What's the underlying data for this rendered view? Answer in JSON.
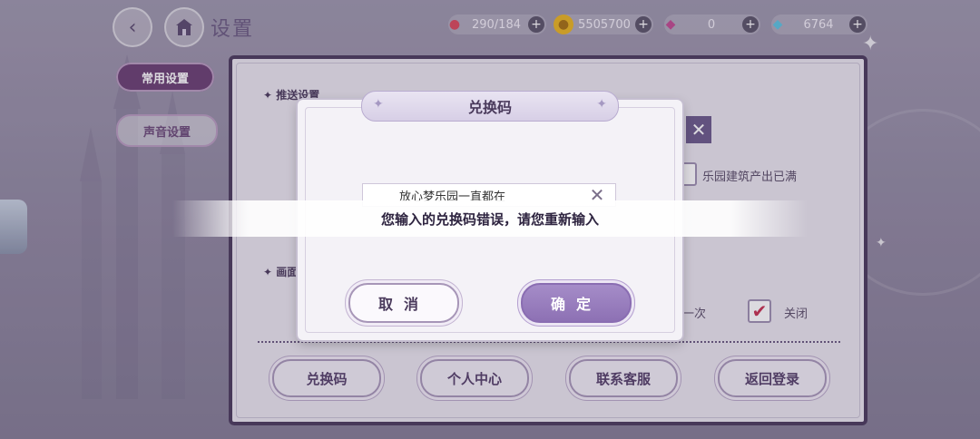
{
  "header": {
    "back_icon": "back-arrow-icon",
    "home_icon": "castle-home-icon",
    "title": "设置",
    "resources": [
      {
        "icon": "candy-icon",
        "value": "290/184",
        "color": "#d94a5c"
      },
      {
        "icon": "gold-coin-icon",
        "value": "5505700",
        "color": "#e8b420"
      },
      {
        "icon": "pink-diamond-icon",
        "value": "0",
        "color": "#c04a90"
      },
      {
        "icon": "blue-diamond-icon",
        "value": "6764",
        "color": "#5cc3e0"
      }
    ],
    "plus": "+"
  },
  "sidebar": {
    "tabs": [
      {
        "label": "常用设置",
        "active": true
      },
      {
        "label": "声音设置",
        "active": false
      }
    ]
  },
  "panel": {
    "section_push": "推送设置",
    "section_display": "画面",
    "paradise_full": "乐园建筑产出已满",
    "once_tail": "一次",
    "close_label": "关闭",
    "bottom_buttons": [
      "兑换码",
      "个人中心",
      "联系客服",
      "返回登录"
    ]
  },
  "dialog": {
    "title": "兑换码",
    "input_value": "放心梦乐园一直都在",
    "cancel_label": "取消",
    "ok_label": "确定"
  },
  "toast": {
    "message": "您输入的兑换码错误，请您重新输入"
  },
  "colors": {
    "accent": "#6a3f72",
    "ok_button": "#9a7fc0",
    "panel_border": "#4a3a5c"
  }
}
